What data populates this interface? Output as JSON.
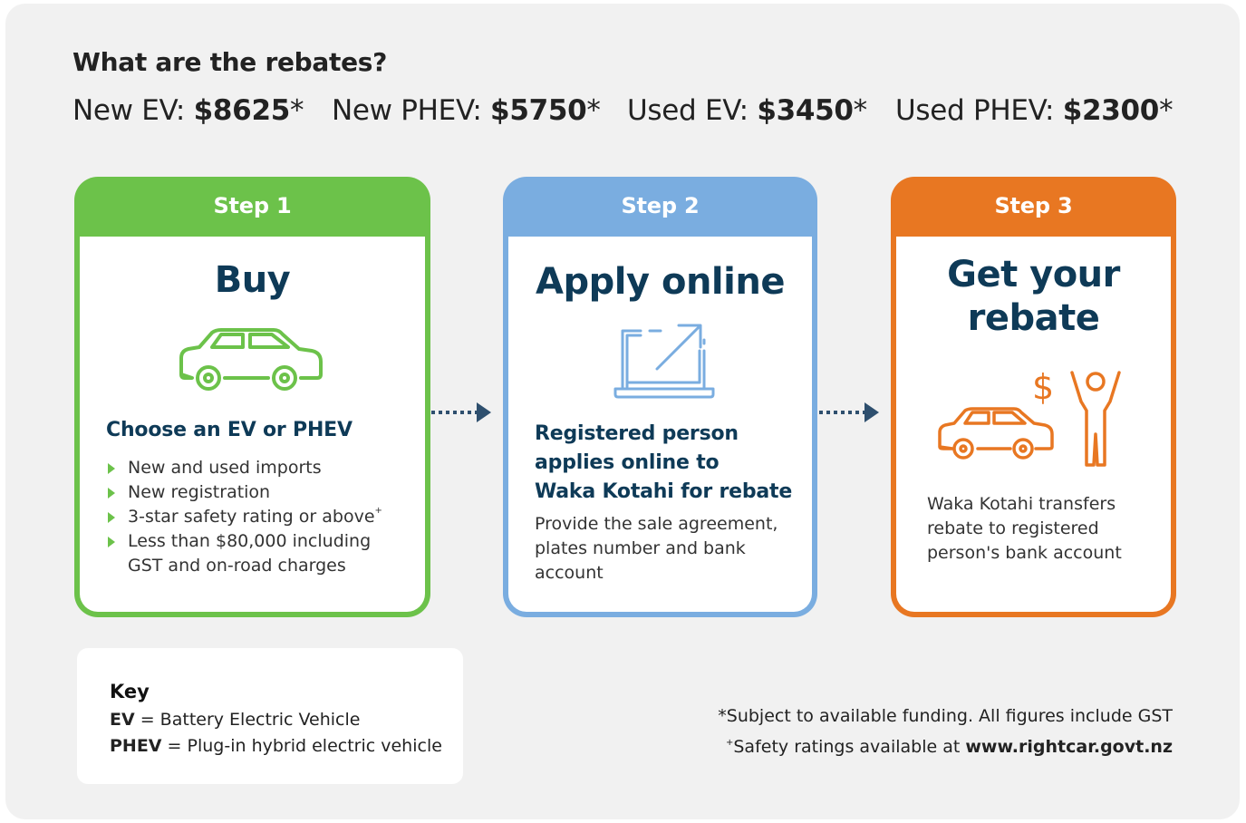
{
  "title": "What are the rebates?",
  "rebates": [
    {
      "label": "New EV: ",
      "amount": "$8625",
      "mark": "*"
    },
    {
      "label": "New PHEV: ",
      "amount": "$5750",
      "mark": "*"
    },
    {
      "label": "Used EV: ",
      "amount": "$3450",
      "mark": "*"
    },
    {
      "label": "Used PHEV: ",
      "amount": "$2300",
      "mark": "*"
    }
  ],
  "steps": [
    {
      "label": "Step 1",
      "heading": "Buy",
      "subheading": "Choose an EV or PHEV",
      "bullets": [
        "New and used imports",
        "New registration",
        "3-star safety rating or above",
        "Less than $80,000 including",
        "GST and on-road charges"
      ],
      "bullet_sup": "+",
      "color": "#6cc24a",
      "icon": "car-icon"
    },
    {
      "label": "Step 2",
      "heading": "Apply online",
      "subheading_lines": [
        "Registered person",
        "applies online to",
        "Waka Kotahi for rebate"
      ],
      "body_lines": [
        "Provide the sale agreement,",
        "plates number and bank",
        "account"
      ],
      "color": "#7aade0",
      "icon": "laptop-icon"
    },
    {
      "label": "Step 3",
      "heading_lines": [
        "Get your",
        "rebate"
      ],
      "body_lines": [
        "Waka Kotahi transfers",
        "rebate to registered",
        "person's bank account"
      ],
      "color": "#e87722",
      "icon": "car-dollar-celebrate-icon",
      "icon_text": "$"
    }
  ],
  "key": {
    "title": "Key",
    "rows": [
      {
        "abbr": "EV",
        "desc": " = Battery Electric Vehicle"
      },
      {
        "abbr": "PHEV",
        "desc": " = Plug-in hybrid electric vehicle"
      }
    ]
  },
  "footnotes": {
    "funding": "*Subject to available funding. All figures include GST",
    "safety_sup": "+",
    "safety_text": "Safety ratings available at ",
    "safety_link": "www.rightcar.govt.nz"
  },
  "colors": {
    "dark_blue": "#0e3a57",
    "arrow": "#2e4f6e",
    "background": "#f1f1f1"
  }
}
